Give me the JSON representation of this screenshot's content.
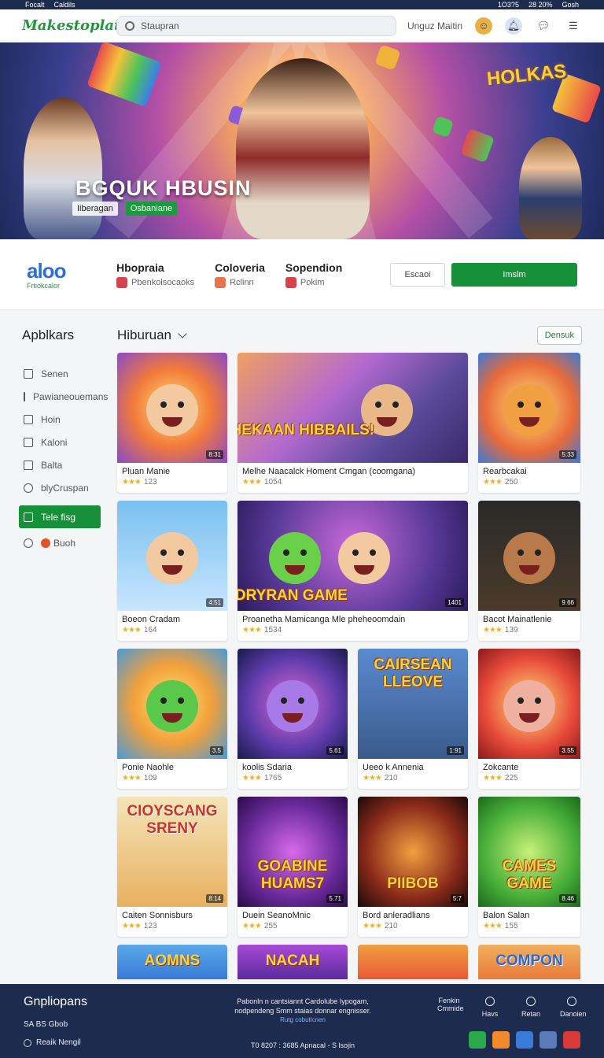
{
  "status": {
    "left1": "Focalt",
    "left2": "Caldils",
    "right1": "1O3?5",
    "right2": "28 20%",
    "right3": "Gosh"
  },
  "topbar": {
    "logo": "Makestoplate",
    "search_placeholder": "Staupran",
    "user_label": "Unguz Maitin"
  },
  "hero": {
    "title": "BGQUK HBUSIN",
    "tag1": "Iiberagan",
    "tag2": "Osbaniane",
    "badge": "HOLKAS"
  },
  "featured": {
    "logo_text": "aloo",
    "logo_sub": "Frtiokcalor",
    "col1_title": "Hbopraia",
    "col1_sub": "Pbenkolsocaoks",
    "col2_title": "Coloveria",
    "col2_sub": "Rclinn",
    "col3_title": "Sopendion",
    "col3_sub": "Pokim",
    "btn_secondary": "Escaoi",
    "btn_primary": "Imslm"
  },
  "sidebar": {
    "title": "Apblkars",
    "items": [
      {
        "label": "Senen",
        "icon": "home-icon"
      },
      {
        "label": "Pawianeouemans",
        "icon": "edit-icon"
      },
      {
        "label": "Hoin",
        "icon": "folder-icon"
      },
      {
        "label": "Kaloni",
        "icon": "square-icon"
      },
      {
        "label": "Balta",
        "icon": "file-icon"
      },
      {
        "label": "blyCruspan",
        "icon": "undo-icon"
      },
      {
        "label": "Tele fisg",
        "icon": "list-icon"
      },
      {
        "label": "Buoh",
        "icon": "gear-icon"
      }
    ]
  },
  "content": {
    "title": "Hiburuan",
    "sort_button": "Densuk",
    "cards": [
      {
        "name": "Pluan Manie",
        "rating": "123",
        "badge": "8:31"
      },
      {
        "name": "Melhe Naacalck Homent Cmgan (coomgana)",
        "rating": "1054",
        "banner": "PHEKAAN HIBBAILS!"
      },
      {
        "name": "Rearbcakai",
        "rating": "250",
        "badge": "5:33"
      },
      {
        "name": "Boeon Cradam",
        "rating": "164",
        "badge": "4:51"
      },
      {
        "name": "Proanetha Mamicanga Mle pheheoomdain",
        "rating": "1534",
        "banner": "HDRYRAN GAME",
        "badge": "1401"
      },
      {
        "name": "Bacot Mainatlenie",
        "rating": "139",
        "badge": "9.66"
      },
      {
        "name": "Ponie Naohle",
        "rating": "109",
        "badge": "3.5"
      },
      {
        "name": "koolis Sdaria",
        "rating": "1765",
        "badge": "5.61"
      },
      {
        "name": "Ueeo k Annenia",
        "rating": "210",
        "banner": "CAIRSEAN LLEOVE",
        "badge": "1:91"
      },
      {
        "name": "Zokcante",
        "rating": "225",
        "badge": "3.55"
      },
      {
        "name": "Caiten Sonnisburs",
        "rating": "123",
        "banner": "CIOYSCANG SRENY",
        "badge": "8:14"
      },
      {
        "name": "Duein SeanoMnic",
        "rating": "255",
        "banner": "GOABINE HUAMS7",
        "badge": "5.71"
      },
      {
        "name": "Bord anleradlians",
        "rating": "210",
        "banner": "PIIBOB",
        "badge": "5:7"
      },
      {
        "name": "Balon Salan",
        "rating": "155",
        "banner": "CAMES GAME",
        "badge": "8.46"
      }
    ],
    "partial": [
      "AOMNS",
      "NACAH",
      "",
      "COMPON"
    ]
  },
  "footer": {
    "title": "Gnpliopans",
    "row1": "SA BS Gbob",
    "row2": "Reaik Nengil",
    "center1": "Pabonln n cantsiannt Cardolube Iypogam,",
    "center2": "nodpendeng Smm staias donnar engnisser.",
    "center_link": "Rutg cobuticnen",
    "copyright": "T0 8207 : 3685 Apnacal - S lsojin",
    "links": [
      "Fenkin Cmmide",
      "Havs",
      "Retan",
      "Danoien"
    ]
  },
  "colors": {
    "accent": "#16913a",
    "footer": "#1d2b4f",
    "logo": "#1c9a3c"
  }
}
